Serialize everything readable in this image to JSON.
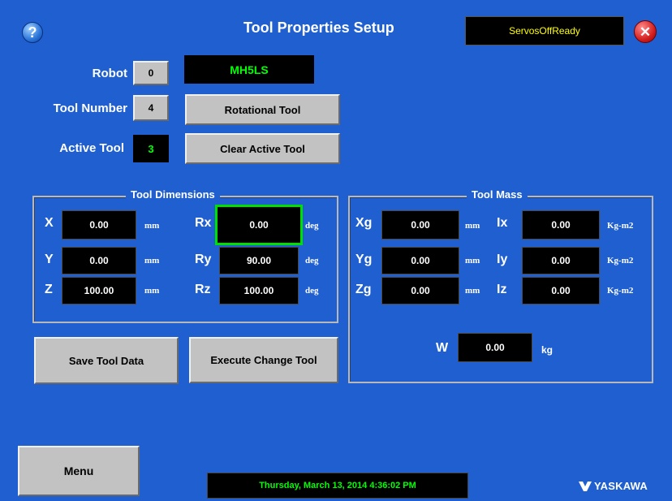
{
  "header": {
    "title": "Tool Properties Setup",
    "status": "ServosOffReady",
    "help_icon_glyph": "?",
    "close_icon_glyph": "✕"
  },
  "robot": {
    "robot_label": "Robot",
    "robot_index": "0",
    "robot_model": "MH5LS",
    "tool_number_label": "Tool Number",
    "tool_number": "4",
    "active_tool_label": "Active Tool",
    "active_tool": "3",
    "rotational_tool_label": "Rotational Tool",
    "clear_active_tool_label": "Clear Active Tool"
  },
  "tool_dimensions": {
    "title": "Tool Dimensions",
    "rows": [
      {
        "axis": "X",
        "value": "0.00",
        "unit": "mm",
        "rot_axis": "Rx",
        "rot_value": "0.00",
        "rot_unit": "deg"
      },
      {
        "axis": "Y",
        "value": "0.00",
        "unit": "mm",
        "rot_axis": "Ry",
        "rot_value": "90.00",
        "rot_unit": "deg"
      },
      {
        "axis": "Z",
        "value": "100.00",
        "unit": "mm",
        "rot_axis": "Rz",
        "rot_value": "100.00",
        "rot_unit": "deg"
      }
    ]
  },
  "tool_mass": {
    "title": "Tool Mass",
    "rows": [
      {
        "axis": "Xg",
        "value": "0.00",
        "unit": "mm",
        "inertia_axis": "Ix",
        "inertia_value": "0.00",
        "inertia_unit": "Kg-m2"
      },
      {
        "axis": "Yg",
        "value": "0.00",
        "unit": "mm",
        "inertia_axis": "Iy",
        "inertia_value": "0.00",
        "inertia_unit": "Kg-m2"
      },
      {
        "axis": "Zg",
        "value": "0.00",
        "unit": "mm",
        "inertia_axis": "Iz",
        "inertia_value": "0.00",
        "inertia_unit": "Kg-m2"
      }
    ],
    "weight_label": "W",
    "weight_value": "0.00",
    "weight_unit": "kg"
  },
  "actions": {
    "save_label": "Save Tool Data",
    "execute_label": "Execute Change Tool",
    "menu_label": "Menu"
  },
  "footer": {
    "datetime": "Thursday, March 13, 2014 4:36:02 PM",
    "brand": "YASKAWA"
  },
  "colors": {
    "background": "#1f5fd0",
    "status_text": "#ffff00",
    "ok_text": "#00ff00",
    "focus_border": "#00e000"
  }
}
